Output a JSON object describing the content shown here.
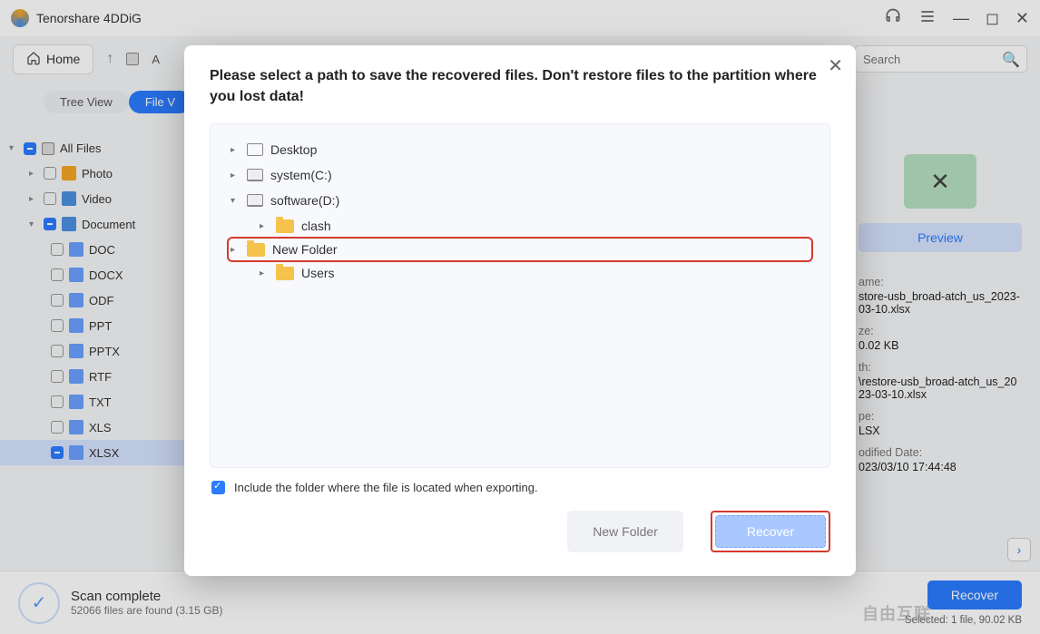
{
  "titlebar": {
    "app_name": "Tenorshare 4DDiG"
  },
  "toolbar": {
    "home_label": "Home",
    "breadcrumb_partial": "A",
    "search_placeholder": "Search"
  },
  "viewtabs": {
    "tree": "Tree View",
    "file": "File V"
  },
  "sidebar": {
    "all_files": "All Files",
    "photo": "Photo",
    "video": "Video",
    "document": "Document",
    "doc_types": [
      "DOC",
      "DOCX",
      "ODF",
      "PPT",
      "PPTX",
      "RTF",
      "TXT",
      "XLS",
      "XLSX"
    ]
  },
  "details": {
    "preview_label": "Preview",
    "name_label": "ame:",
    "name_value": "store-usb_broad-atch_us_2023-03-10.xlsx",
    "size_label": "ze:",
    "size_value": "0.02 KB",
    "path_label": "th:",
    "path_value": "\\restore-usb_broad-atch_us_2023-03-10.xlsx",
    "type_label": "pe:",
    "type_value": "LSX",
    "modified_label": "odified Date:",
    "modified_value": "023/03/10 17:44:48"
  },
  "footer": {
    "scan_title": "Scan complete",
    "scan_sub": "52066 files are found (3.15 GB)",
    "recover_label": "Recover",
    "selected_label": "Selected: 1 file, 90.02 KB",
    "watermark": "自由互联"
  },
  "modal": {
    "header": "Please select a path to save the recovered files. Don't restore files to the partition where you lost data!",
    "tree": {
      "desktop": "Desktop",
      "system_c": "system(C:)",
      "software_d": "software(D:)",
      "clash": "clash",
      "new_folder": "New Folder",
      "users": "Users"
    },
    "include_label": "Include the folder where the file is located when exporting.",
    "new_folder_btn": "New Folder",
    "recover_btn": "Recover"
  }
}
